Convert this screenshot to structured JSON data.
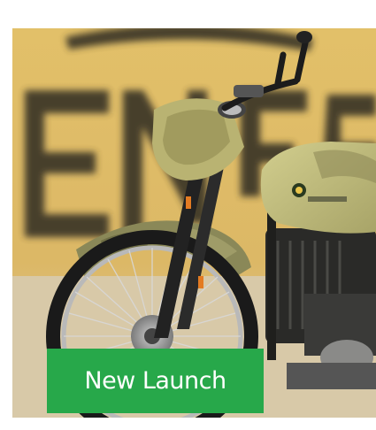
{
  "product_card": {
    "badge_label": "New Launch",
    "image_icon": "motorcycle-photo",
    "colors": {
      "badge_bg": "#27a84a",
      "badge_text": "#ffffff",
      "backdrop": "#dcb866",
      "lettering": "#3a3628",
      "floor": "#d8c9a8",
      "tank_khaki": "#bdb877",
      "engine": "#2a2a28"
    }
  }
}
